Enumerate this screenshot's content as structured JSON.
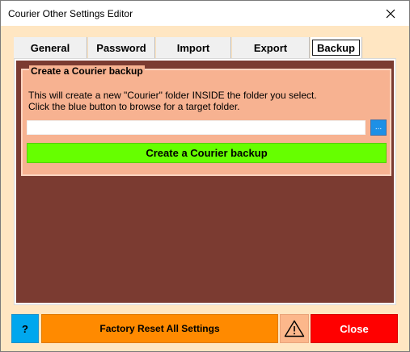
{
  "window": {
    "title": "Courier Other Settings Editor",
    "close_glyph": "✕"
  },
  "tabs": [
    {
      "label": "General",
      "active": false
    },
    {
      "label": "Password",
      "active": false
    },
    {
      "label": "Import",
      "active": false
    },
    {
      "label": "Export",
      "active": false
    },
    {
      "label": "Backup",
      "active": true
    }
  ],
  "backup": {
    "group_title": "Create a Courier backup",
    "description_line1": "This will create a new \"Courier\" folder INSIDE the folder you select.",
    "description_line2": "Click the blue button to browse for a target folder.",
    "path_value": "",
    "browse_label": "...",
    "create_button_label": "Create a Courier backup"
  },
  "footer": {
    "help_label": "?",
    "reset_label": "Factory Reset All Settings",
    "warning_icon": "warning-icon",
    "close_label": "Close"
  },
  "colors": {
    "window_bg": "#ffe6c2",
    "panel_bg": "#7b3b31",
    "group_bg": "#f7b291",
    "browse": "#1e90e6",
    "create": "#66ff00",
    "help": "#00a7ee",
    "reset": "#ff8a00",
    "warn": "#fcb78b",
    "close": "#ff0000"
  }
}
